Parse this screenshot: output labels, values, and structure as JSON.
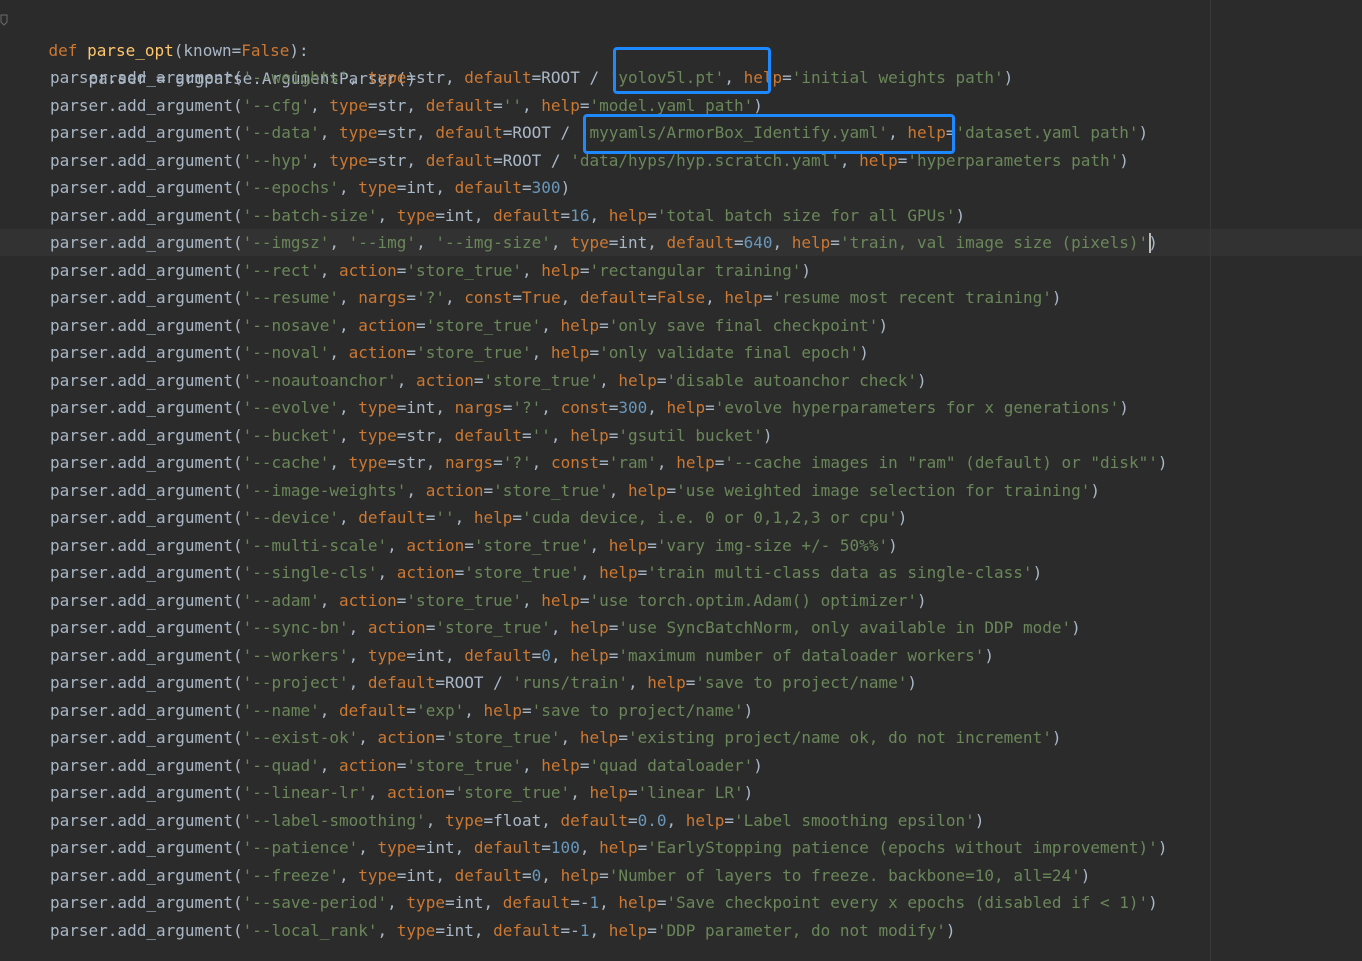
{
  "editor": {
    "def_line": {
      "kw": "def",
      "fn": "parse_opt",
      "param": "known",
      "value": "False"
    },
    "parser_line": "parser = argparse.ArgumentParser()",
    "lines": [
      "parser.add_argument('--weights', type=str, default=ROOT / 'yolov5l.pt', help='initial weights path')",
      "parser.add_argument('--cfg', type=str, default='', help='model.yaml path')",
      "parser.add_argument('--data', type=str, default=ROOT / 'myyamls/ArmorBox_Identify.yaml', help='dataset.yaml path')",
      "parser.add_argument('--hyp', type=str, default=ROOT / 'data/hyps/hyp.scratch.yaml', help='hyperparameters path')",
      "parser.add_argument('--epochs', type=int, default=300)",
      "parser.add_argument('--batch-size', type=int, default=16, help='total batch size for all GPUs')",
      "parser.add_argument('--imgsz', '--img', '--img-size', type=int, default=640, help='train, val image size (pixels)')",
      "parser.add_argument('--rect', action='store_true', help='rectangular training')",
      "parser.add_argument('--resume', nargs='?', const=True, default=False, help='resume most recent training')",
      "parser.add_argument('--nosave', action='store_true', help='only save final checkpoint')",
      "parser.add_argument('--noval', action='store_true', help='only validate final epoch')",
      "parser.add_argument('--noautoanchor', action='store_true', help='disable autoanchor check')",
      "parser.add_argument('--evolve', type=int, nargs='?', const=300, help='evolve hyperparameters for x generations')",
      "parser.add_argument('--bucket', type=str, default='', help='gsutil bucket')",
      "parser.add_argument('--cache', type=str, nargs='?', const='ram', help='--cache images in \"ram\" (default) or \"disk\"')",
      "parser.add_argument('--image-weights', action='store_true', help='use weighted image selection for training')",
      "parser.add_argument('--device', default='', help='cuda device, i.e. 0 or 0,1,2,3 or cpu')",
      "parser.add_argument('--multi-scale', action='store_true', help='vary img-size +/- 50%%')",
      "parser.add_argument('--single-cls', action='store_true', help='train multi-class data as single-class')",
      "parser.add_argument('--adam', action='store_true', help='use torch.optim.Adam() optimizer')",
      "parser.add_argument('--sync-bn', action='store_true', help='use SyncBatchNorm, only available in DDP mode')",
      "parser.add_argument('--workers', type=int, default=0, help='maximum number of dataloader workers')",
      "parser.add_argument('--project', default=ROOT / 'runs/train', help='save to project/name')",
      "parser.add_argument('--name', default='exp', help='save to project/name')",
      "parser.add_argument('--exist-ok', action='store_true', help='existing project/name ok, do not increment')",
      "parser.add_argument('--quad', action='store_true', help='quad dataloader')",
      "parser.add_argument('--linear-lr', action='store_true', help='linear LR')",
      "parser.add_argument('--label-smoothing', type=float, default=0.0, help='Label smoothing epsilon')",
      "parser.add_argument('--patience', type=int, default=100, help='EarlyStopping patience (epochs without improvement)')",
      "parser.add_argument('--freeze', type=int, default=0, help='Number of layers to freeze. backbone=10, all=24')",
      "parser.add_argument('--save-period', type=int, default=-1, help='Save checkpoint every x epochs (disabled if < 1)')",
      "parser.add_argument('--local_rank', type=int, default=-1, help='DDP parameter, do not modify')"
    ]
  },
  "colors": {
    "background": "#2b2b2b",
    "text": "#a9b7c6",
    "keyword": "#cc7832",
    "function": "#ffc66d",
    "string": "#6a8759",
    "number": "#6897bb",
    "highlight_box": "#1e88ff"
  }
}
